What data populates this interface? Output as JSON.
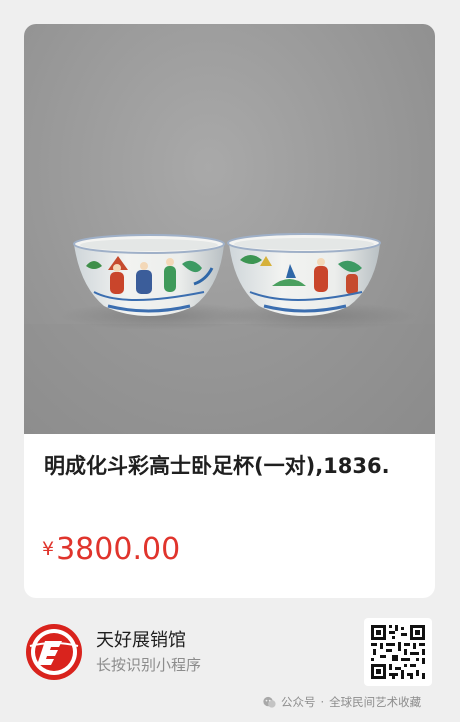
{
  "product": {
    "title": "明成化斗彩高士卧足杯(一对),1836.",
    "currency_symbol": "¥",
    "price": "3800.00",
    "image_icon": "porcelain-cups-photo"
  },
  "store": {
    "name": "天好展销馆",
    "subtitle": "长按识别小程序",
    "logo_icon": "store-logo-icon",
    "qr_icon": "mini-program-qr-icon"
  },
  "watermark": {
    "platform": "公众号",
    "separator": "·",
    "account": "全球民间艺术收藏",
    "icon": "wechat-icon"
  },
  "colors": {
    "price": "#e0342c",
    "logo_red": "#d9231d",
    "card_background": "#ffffff",
    "page_background": "#efefef"
  }
}
